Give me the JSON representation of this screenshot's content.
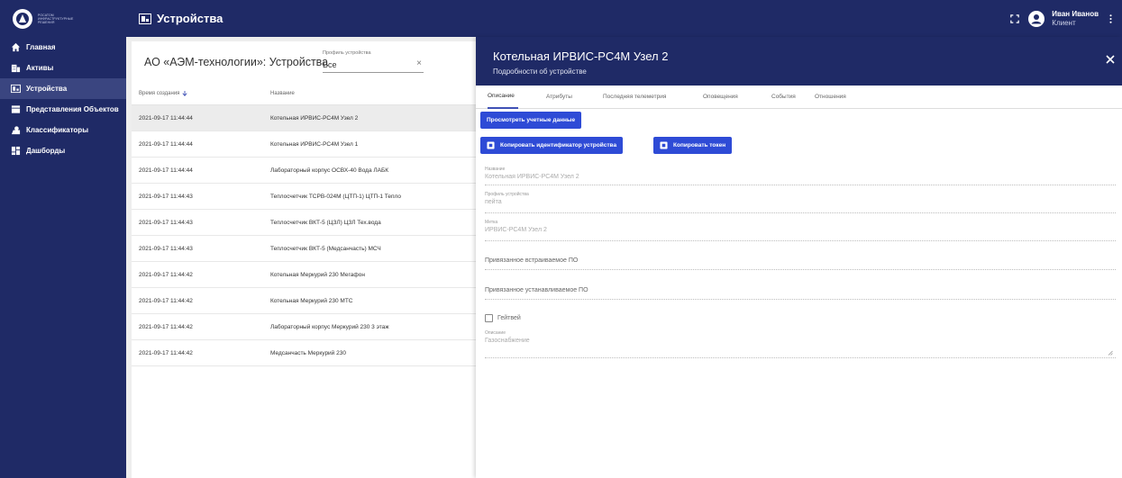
{
  "app": {
    "logo_text": "РОСАТОМ ИНФРАСТРУКТУРНЫЕ РЕШЕНИЯ",
    "section_title": "Устройства",
    "colors": {
      "brand": "#1f2a66",
      "accent": "#2e4bd6",
      "sidebar_active": "#3a4580"
    }
  },
  "user": {
    "name": "Иван Иванов",
    "role": "Клиент"
  },
  "sidebar": {
    "items": [
      {
        "label": "Главная",
        "icon": "home-icon"
      },
      {
        "label": "Активы",
        "icon": "building-icon"
      },
      {
        "label": "Устройства",
        "icon": "device-icon",
        "active": true
      },
      {
        "label": "Представления Объектов",
        "icon": "view-icon"
      },
      {
        "label": "Классификаторы",
        "icon": "classifier-icon"
      },
      {
        "label": "Дашборды",
        "icon": "dashboard-icon"
      }
    ]
  },
  "list": {
    "title": "АО «АЭМ-технологии»: Устройства",
    "filter": {
      "label": "Профиль устройства",
      "value": "Все"
    },
    "columns": {
      "created": "Время создания",
      "name": "Название"
    },
    "rows": [
      {
        "created": "2021-09-17 11:44:44",
        "name": "Котельная ИРВИС-РС4М Узел 2"
      },
      {
        "created": "2021-09-17 11:44:44",
        "name": "Котельная ИРВИС-РС4М Узел 1"
      },
      {
        "created": "2021-09-17 11:44:44",
        "name": "Лабораторный корпус ОСВХ-40 Вода ЛАБК"
      },
      {
        "created": "2021-09-17 11:44:43",
        "name": "Теплосчетчик ТСРВ-024М (ЦТП-1) ЦТП-1 Тепло"
      },
      {
        "created": "2021-09-17 11:44:43",
        "name": "Теплосчетчик ВКТ-5 (ЦЗЛ) ЦЗЛ Тех.вода"
      },
      {
        "created": "2021-09-17 11:44:43",
        "name": "Теплосчетчик ВКТ-5 (Медсанчасть) МСЧ"
      },
      {
        "created": "2021-09-17 11:44:42",
        "name": "Котельная Меркурий 230 Мегафон"
      },
      {
        "created": "2021-09-17 11:44:42",
        "name": "Котельная Меркурий 230 МТС"
      },
      {
        "created": "2021-09-17 11:44:42",
        "name": "Лабораторный корпус Меркурий 230 3 этаж"
      },
      {
        "created": "2021-09-17 11:44:42",
        "name": "Медсанчасть Меркурий 230"
      }
    ]
  },
  "details": {
    "title": "Котельная ИРВИС-РС4М Узел 2",
    "subtitle": "Подробности об устройстве",
    "tabs": [
      "Описание",
      "Атрибуты",
      "Последняя телеметрия",
      "Оповещения",
      "События",
      "Отношения"
    ],
    "buttons": {
      "credentials": "Просмотреть учетные данные",
      "copy_id": "Копировать идентификатор устройства",
      "copy_token": "Копировать токен"
    },
    "fields": {
      "name_label": "Название",
      "name_value": "Котельная ИРВИС-РС4М Узел 2",
      "profile_label": "Профиль устройства",
      "profile_value": "пейта",
      "label_label": "Метка",
      "label_value": "ИРВИС-РС4М Узел 2",
      "firmware": "Привязанное встраиваемое ПО",
      "software": "Привязанное устанавливаемое ПО",
      "gateway": "Гейтвей",
      "description_label": "Описание",
      "description_value": "Газоснабжение"
    }
  }
}
